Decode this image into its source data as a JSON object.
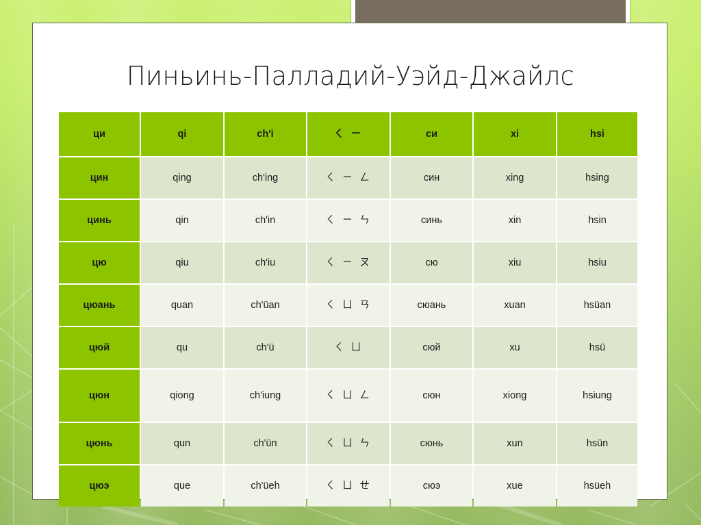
{
  "slide": {
    "title": "Пиньинь-Палладий-Уэйд-Джайлс",
    "colors": {
      "header_green": "#8CC400",
      "row_band_dark": "#DDE5CD",
      "row_band_light": "#EFF3E8",
      "top_box_brown": "#786E60",
      "background_top": "#CDF074",
      "background_bottom": "#96BA61",
      "card_white": "#FFFFFF"
    }
  },
  "table": {
    "name": "pinyin-palladius-wade-giles-table",
    "columns": 7,
    "header": [
      "ци",
      "qi",
      "ch'i",
      "ㄑ ㄧ",
      "си",
      "xi",
      "hsi"
    ],
    "rows": [
      {
        "cells": [
          "цин",
          "qing",
          "ch'ing",
          "ㄑ ㄧ ㄥ",
          "син",
          "xing",
          "hsing"
        ],
        "band": "a",
        "height": "normal"
      },
      {
        "cells": [
          "цинь",
          "qin",
          "ch'in",
          "ㄑ ㄧ ㄣ",
          "синь",
          "xin",
          "hsin"
        ],
        "band": "b",
        "height": "normal"
      },
      {
        "cells": [
          "цю",
          "qiu",
          "ch'iu",
          "ㄑ ㄧ ㄡ",
          "сю",
          "xiu",
          "hsiu"
        ],
        "band": "a",
        "height": "normal"
      },
      {
        "cells": [
          "цюань",
          "quan",
          "ch'üan",
          "ㄑ ㄩ ㄢ",
          "сюань",
          "xuan",
          "hsüan"
        ],
        "band": "b",
        "height": "normal"
      },
      {
        "cells": [
          "цюй",
          "qu",
          "ch'ü",
          "ㄑ ㄩ",
          "сюй",
          "xu",
          "hsü"
        ],
        "band": "a",
        "height": "normal"
      },
      {
        "cells": [
          "цюн",
          "qiong",
          "ch'iung",
          "ㄑ ㄩ ㄥ",
          "сюн",
          "xiong",
          "hsiung"
        ],
        "band": "b",
        "height": "tall"
      },
      {
        "cells": [
          "цюнь",
          "qun",
          "ch'ün",
          "ㄑ ㄩ ㄣ",
          "сюнь",
          "xun",
          "hsün"
        ],
        "band": "a",
        "height": "normal"
      },
      {
        "cells": [
          "цюэ",
          "que",
          "ch'üeh",
          "ㄑ ㄩ ㄝ",
          "сюэ",
          "xue",
          "hsüeh"
        ],
        "band": "b",
        "height": "normal"
      }
    ]
  }
}
